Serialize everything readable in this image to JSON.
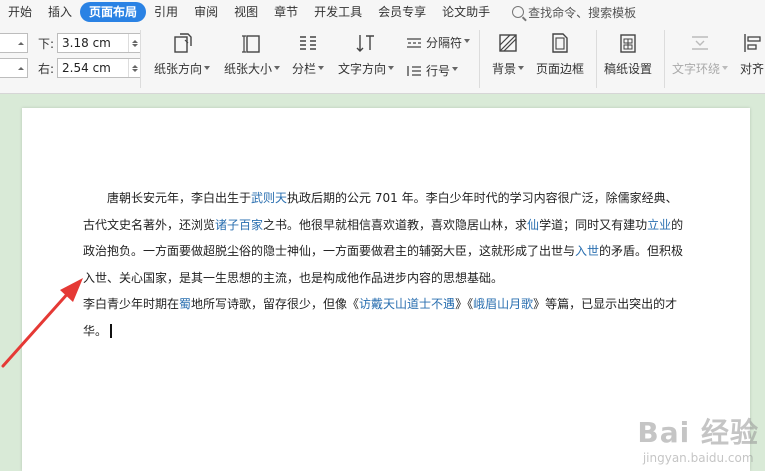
{
  "menu": {
    "tabs": [
      "开始",
      "插入",
      "页面布局",
      "引用",
      "审阅",
      "视图",
      "章节",
      "开发工具",
      "会员专享",
      "论文助手"
    ],
    "active": "页面布局",
    "search": "查找命令、搜索模板"
  },
  "ribbon": {
    "margin_bottom_label": "下:",
    "margin_bottom_value": "3.18 cm",
    "margin_right_label": "右:",
    "margin_right_value": "2.54 cm",
    "orientation": "纸张方向",
    "size": "纸张大小",
    "columns": "分栏",
    "text_direction": "文字方向",
    "separator": "分隔符",
    "line_number": "行号",
    "background": "背景",
    "page_border": "页面边框",
    "grid_paper": "稿纸设置",
    "text_wrap": "文字环绕",
    "align": "对齐"
  },
  "document": {
    "p1_s1": "唐朝长安元年，李白出生于",
    "p1_l1": "武则天",
    "p1_s2": "执政后期的公元 701 年。李白少年时代的学习内容很广泛，除儒家经典、古代文史名著外，还浏览",
    "p1_l2": "诸子百家",
    "p1_s3": "之书。他很早就相信喜欢道教，喜欢隐居山林，求",
    "p1_l3": "仙",
    "p1_s4": "学道；同时又有建功",
    "p1_l4": "立业",
    "p1_s5": "的政治抱负。一方面要做超脱尘俗的隐士神仙，一方面要做君主的辅弼大臣，这就形成了出世与",
    "p1_l5": "入世",
    "p1_s6": "的矛盾。但积极入世、关心国家，是其一生思想的主流，也是构成他作品进步内容的思想基础。",
    "p2_s1": "李白青少年时期在",
    "p2_l1": "蜀",
    "p2_s2": "地所写诗歌，留存很少，但像《",
    "p2_l2": "访戴天山道士不遇",
    "p2_s3": "》《",
    "p2_l3": "峨眉山月歌",
    "p2_s4": "》等篇，已显示出突出的才华。"
  },
  "watermark": {
    "logo": "Bai 经验",
    "url": "jingyan.baidu.com"
  },
  "colors": {
    "accent": "#2a82e4",
    "link": "#2a6fb0",
    "annotation_arrow": "#e53935",
    "canvas": "#d9ead7"
  }
}
